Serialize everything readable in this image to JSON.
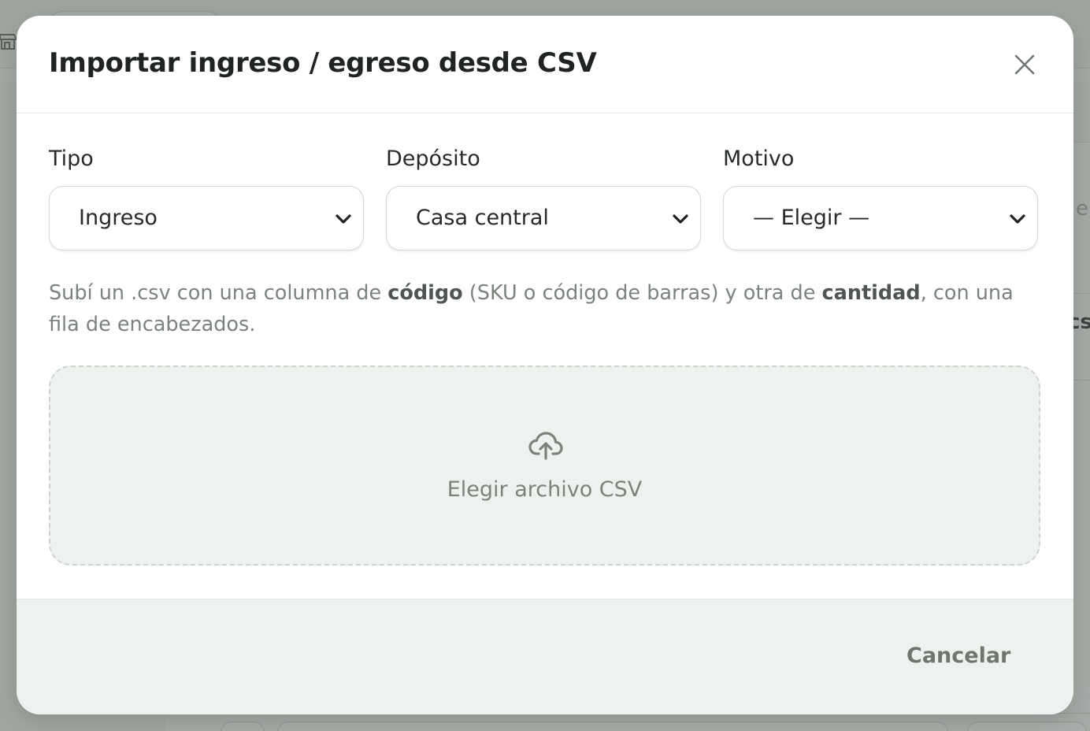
{
  "modal": {
    "title": "Importar ingreso / egreso desde CSV",
    "close_icon": "close-icon"
  },
  "fields": {
    "tipo": {
      "label": "Tipo",
      "value": "Ingreso"
    },
    "deposito": {
      "label": "Depósito",
      "value": "Casa central"
    },
    "motivo": {
      "label": "Motivo",
      "value": "— Elegir —"
    }
  },
  "help": {
    "part1": "Subí un .csv con una columna de ",
    "bold1": "código",
    "part2": " (SKU o código de barras) y otra de ",
    "bold2": "cantidad",
    "part3": ", con una fila de encabezados."
  },
  "dropzone": {
    "icon": "cloud-upload-icon",
    "label": "Elegir archivo CSV"
  },
  "footer": {
    "cancel_label": "Cancelar"
  },
  "background": {
    "partial_text_1": "e",
    "partial_text_2": "cs"
  },
  "colors": {
    "overlay": "#a3a9a4",
    "modal_bg": "#ffffff",
    "footer_bg": "#eef2ef",
    "title": "#1f2421",
    "muted": "#7b837d"
  }
}
